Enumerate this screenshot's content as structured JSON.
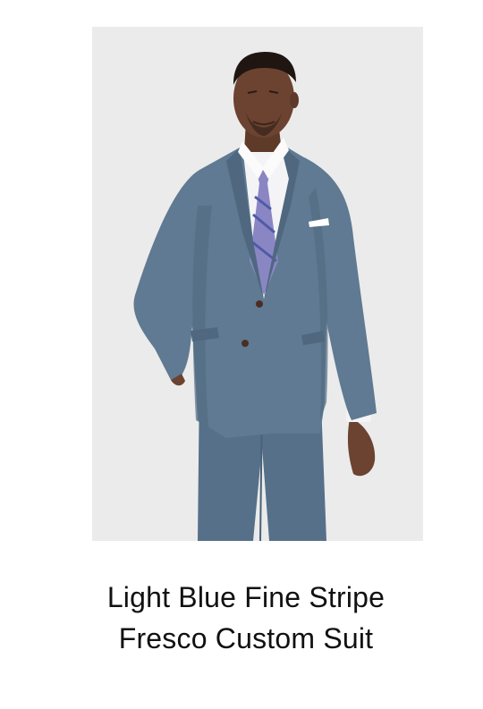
{
  "product": {
    "title_line_1": "Light Blue Fine Stripe",
    "title_line_2": "Fresco Custom Suit",
    "image_icon": "suit-model-photo",
    "colors": {
      "background": "#ebebeb",
      "suit": "#5f7a92",
      "tie": "#8a86c4",
      "shirt": "#f4f4f6",
      "skin": "#6b4330"
    }
  }
}
